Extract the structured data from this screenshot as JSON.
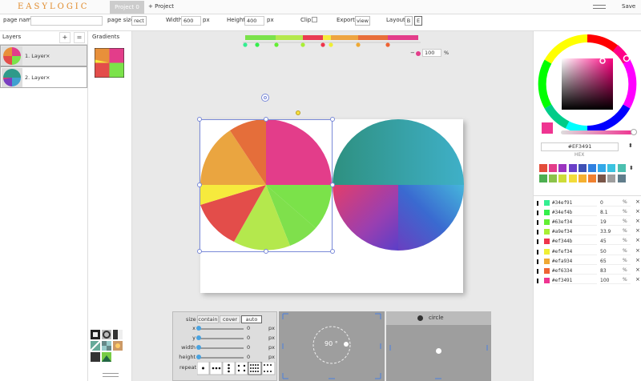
{
  "app": {
    "logo": "EASYLOGIC",
    "project_tab": "Project 0",
    "add_project": "+ Project",
    "save": "Save"
  },
  "propbar": {
    "page_name_label": "page name",
    "page_name_value": "",
    "page_size_label": "page size",
    "page_size_value": "rect",
    "width_label": "Width",
    "width_value": "600",
    "width_unit": "px",
    "height_label": "Height",
    "height_value": "400",
    "height_unit": "px",
    "clip_label": "Clip",
    "export_label": "Export",
    "export_button": "view",
    "layout_label": "Layout",
    "layout_b": "B",
    "layout_e": "E"
  },
  "layers": {
    "title": "Layers",
    "add": "+",
    "menu": "=",
    "items": [
      {
        "name": "1. Layer",
        "remove": "×"
      },
      {
        "name": "2. Layer",
        "remove": "×"
      }
    ]
  },
  "gradients": {
    "title": "Gradients"
  },
  "stopbar": {
    "opacity_minus": "−",
    "opacity_value": "100",
    "opacity_unit": "%",
    "segments": [
      "#7be24a",
      "#b4e84d",
      "#e93c52",
      "#f6ea3d",
      "#eea440",
      "#e86e3a",
      "#e33d8a"
    ]
  },
  "color_picker": {
    "current_color": "#EF3491",
    "hex_label": "HEX",
    "swatches": [
      "#e34d3a",
      "#e33d8a",
      "#9b34c0",
      "#6a3fc8",
      "#3f51b5",
      "#2f80e0",
      "#32a8e8",
      "#3bc3e0",
      "#4cc0b0",
      "#4caf50",
      "#8bc34a",
      "#cddc39",
      "#f2dc3a",
      "#f5b030",
      "#f08030",
      "#795548",
      "#9e9e9e",
      "#607d8b"
    ]
  },
  "stops": [
    {
      "hex": "#34ef91",
      "pct": "0",
      "unit": "%",
      "remove": "×",
      "color": "#34ef91"
    },
    {
      "hex": "#34ef4b",
      "pct": "8.1",
      "unit": "%",
      "remove": "×",
      "color": "#34ef4b"
    },
    {
      "hex": "#63ef34",
      "pct": "19",
      "unit": "%",
      "remove": "×",
      "color": "#63ef34"
    },
    {
      "hex": "#a9ef34",
      "pct": "33.9",
      "unit": "%",
      "remove": "×",
      "color": "#a9ef34"
    },
    {
      "hex": "#ef344b",
      "pct": "45",
      "unit": "%",
      "remove": "×",
      "color": "#ef344b"
    },
    {
      "hex": "#efef34",
      "pct": "50",
      "unit": "%",
      "remove": "×",
      "color": "#efef34"
    },
    {
      "hex": "#efa934",
      "pct": "65",
      "unit": "%",
      "remove": "×",
      "color": "#efa934"
    },
    {
      "hex": "#ef6334",
      "pct": "83",
      "unit": "%",
      "remove": "×",
      "color": "#ef6334"
    },
    {
      "hex": "#ef3491",
      "pct": "100",
      "unit": "%",
      "remove": "×",
      "color": "#ef3491"
    }
  ],
  "background_panel": {
    "size_label": "size",
    "size_options": [
      "contain",
      "cover",
      "auto"
    ],
    "x_label": "x",
    "x_value": "0",
    "x_unit": "px",
    "y_label": "y",
    "y_value": "0",
    "y_unit": "px",
    "width_label": "width",
    "width_value": "0",
    "width_unit": "px",
    "height_label": "height",
    "height_value": "0",
    "height_unit": "px",
    "repeat_label": "repeat"
  },
  "angle_panel": {
    "angle": "90 °"
  },
  "radial_panel": {
    "type": "circle"
  }
}
